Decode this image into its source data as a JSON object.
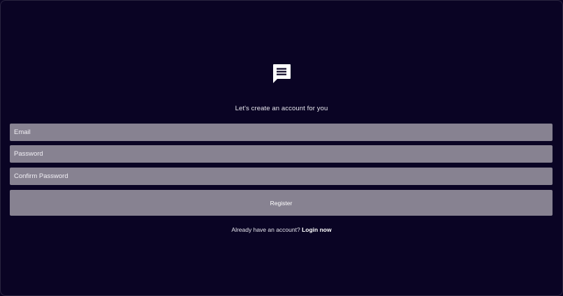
{
  "app": {
    "logo_icon": "chat-bubble-icon",
    "subtitle": "Let's create an account for you"
  },
  "form": {
    "email_placeholder": "Email",
    "email_value": "",
    "password_placeholder": "Password",
    "password_value": "",
    "confirm_placeholder": "Confirm Password",
    "confirm_value": "",
    "register_label": "Register"
  },
  "footer": {
    "prompt": "Already have an account?",
    "link_label": "Login now"
  },
  "colors": {
    "background": "#0a0424",
    "field": "#878291",
    "text": "#ffffff"
  }
}
